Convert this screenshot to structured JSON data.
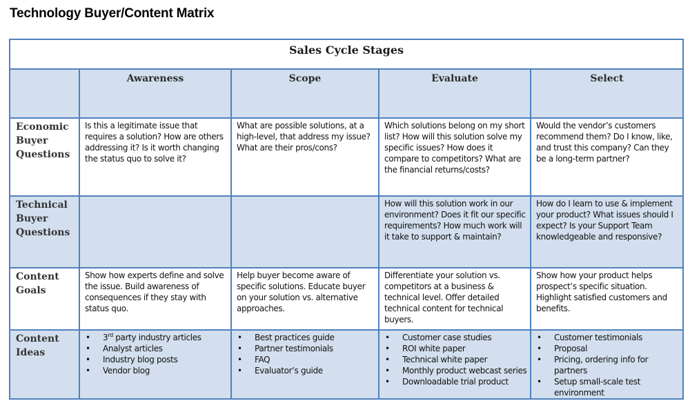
{
  "document": {
    "title": "Technology Buyer/Content Matrix"
  },
  "matrix": {
    "header": "Sales Cycle Stages",
    "stages": [
      "Awareness",
      "Scope",
      "Evaluate",
      "Select"
    ],
    "bullet_glyph": "•",
    "colors": {
      "border": "#4f81bd",
      "header_fill": "#d3dfee"
    },
    "rows": [
      {
        "label": "Economic Buyer Questions",
        "cells": [
          "Is this a legitimate issue that requires a solution?  How are others addressing it? Is it worth changing the status quo to solve it?",
          "What are possible solutions, at a high-level, that address my issue? What are their pros/cons?",
          "Which solutions belong on my short list? How will this solution solve my specific issues? How does it compare to competitors? What are the financial returns/costs?",
          "Would the vendor’s customers recommend them? Do I know, like, and trust this company?  Can they be a long-term partner?"
        ]
      },
      {
        "label": "Technical Buyer Questions",
        "cells": [
          "",
          "",
          "How will this solution work in our environment? Does it fit our specific requirements? How much work will it take to support & maintain?",
          "How do I learn to use & implement your product? What issues should I expect? Is your Support Team knowledgeable and responsive?"
        ]
      },
      {
        "label": "Content Goals",
        "cells": [
          "Show how experts define and solve the issue. Build awareness of consequences if they stay with status quo.",
          "Help buyer become aware of specific solutions. Educate buyer on your solution vs. alternative approaches.",
          "Differentiate your solution vs. competitors at a business & technical level. Offer detailed technical content for technical buyers.",
          "Show how your product helps prospect’s specific situation. Highlight satisfied customers and benefits."
        ]
      },
      {
        "label": "Content Ideas",
        "awareness_first": {
          "num": "3",
          "sup": "rd",
          "rest": " party industry articles"
        },
        "lists": [
          [
            "3rd party industry articles",
            "Analyst articles",
            "Industry blog posts",
            "Vendor blog"
          ],
          [
            "Best practices guide",
            "Partner testimonials",
            "FAQ",
            "Evaluator’s guide"
          ],
          [
            "Customer case studies",
            "ROI white paper",
            "Technical white paper",
            "Monthly product webcast series",
            "Downloadable trial product"
          ],
          [
            "Customer testimonials",
            "Proposal",
            "Pricing, ordering info for partners",
            "Setup small-scale test environment"
          ]
        ]
      }
    ]
  }
}
